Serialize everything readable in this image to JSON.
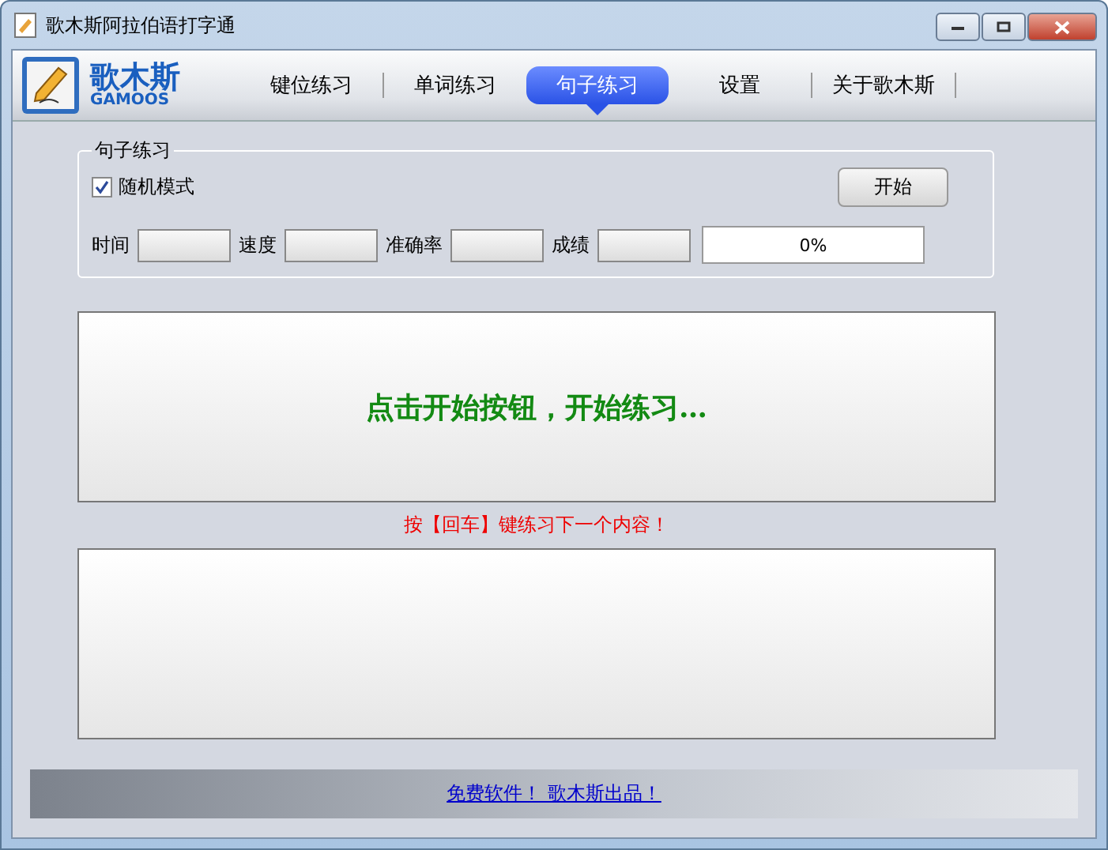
{
  "window": {
    "title": "歌木斯阿拉伯语打字通"
  },
  "logo": {
    "name": "歌木斯",
    "subtitle": "GAMOOS"
  },
  "tabs": [
    {
      "label": "键位练习",
      "selected": false
    },
    {
      "label": "单词练习",
      "selected": false
    },
    {
      "label": "句子练习",
      "selected": true
    },
    {
      "label": "设置",
      "selected": false
    },
    {
      "label": "关于歌木斯",
      "selected": false
    }
  ],
  "practice": {
    "title": "句子练习",
    "random_mode": {
      "label": "随机模式",
      "checked": true
    },
    "start_button": "开始",
    "stats": [
      {
        "label": "时间"
      },
      {
        "label": "速度"
      },
      {
        "label": "准确率"
      },
      {
        "label": "成绩"
      }
    ],
    "progress": {
      "level": 0,
      "reading": "0%"
    }
  },
  "display": {
    "message": "点击开始按钮，开始练习…"
  },
  "hint": "按【回车】键练习下一个内容！",
  "footer": {
    "link": "免费软件！ 歌木斯出品！"
  }
}
